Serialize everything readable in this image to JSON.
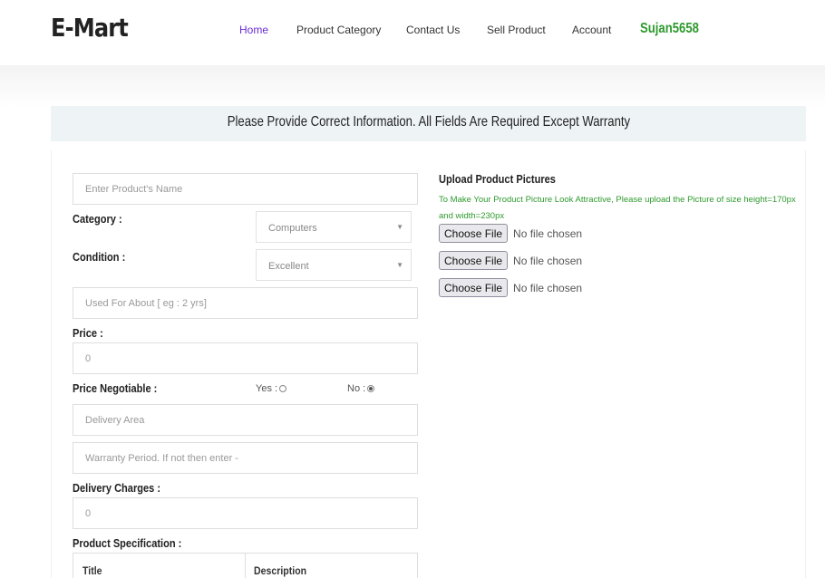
{
  "brand": "E-Mart",
  "nav": {
    "home": "Home",
    "product_category": "Product Category",
    "contact_us": "Contact Us",
    "sell_product": "Sell Product",
    "account": "Account",
    "user": "Sujan5658"
  },
  "notice": "Please Provide Correct Information. All Fields Are Required Except Warranty",
  "form": {
    "name_placeholder": "Enter Product's Name",
    "category_label": "Category :",
    "category_value": "Computers",
    "condition_label": "Condition :",
    "condition_value": "Excellent",
    "used_placeholder": "Used For About [ eg : 2 yrs]",
    "price_label": "Price :",
    "price_placeholder": "0",
    "negotiable_label": "Price Negotiable :",
    "yes_label": "Yes :",
    "no_label": "No :",
    "negotiable_selected": "No",
    "delivery_area_placeholder": "Delivery Area",
    "warranty_placeholder": "Warranty Period. If not then enter -",
    "delivery_charges_label": "Delivery Charges :",
    "delivery_charges_placeholder": "0",
    "spec_label": "Product Specification :",
    "spec_col_title": "Title",
    "spec_col_desc": "Description"
  },
  "upload": {
    "title": "Upload Product Pictures",
    "hint": "To Make Your Product Picture Look Attractive, Please upload the Picture of size height=170px and width=230px",
    "files": [
      {
        "button": "Choose File",
        "status": "No file chosen"
      },
      {
        "button": "Choose File",
        "status": "No file chosen"
      },
      {
        "button": "Choose File",
        "status": "No file chosen"
      }
    ]
  },
  "colors": {
    "nav_active": "#6a2bd6",
    "user": "#2e9a2e",
    "notice_bg": "#eef3f6"
  }
}
